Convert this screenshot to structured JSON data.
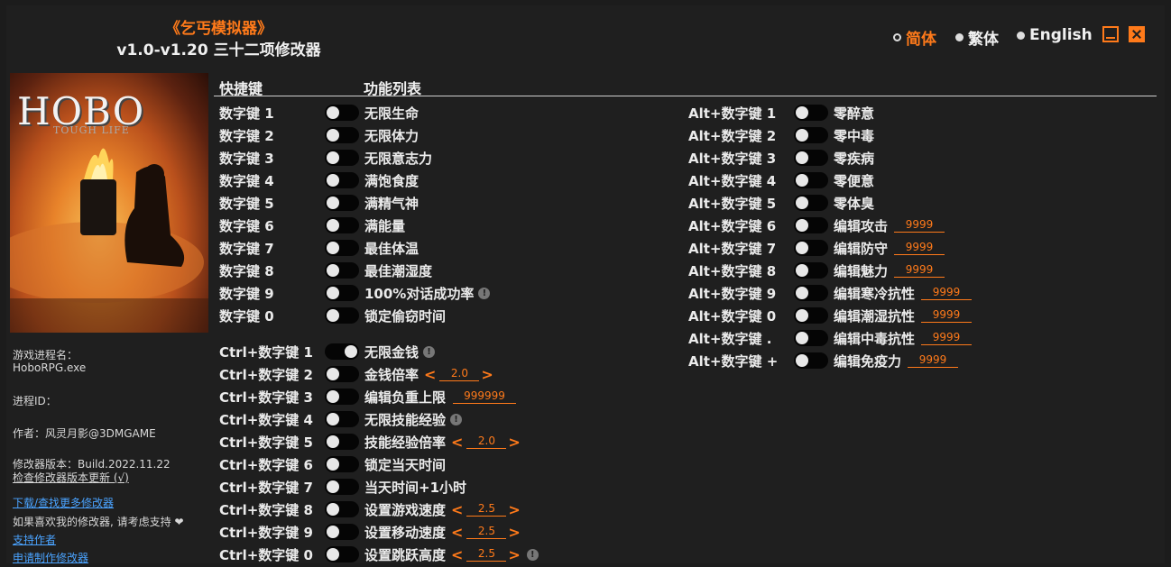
{
  "header": {
    "title": "《乞丐模拟器》",
    "subtitle": "v1.0-v1.20 三十二项修改器"
  },
  "languages": [
    {
      "label": "简体",
      "selected": true
    },
    {
      "label": "繁体",
      "selected": false
    },
    {
      "label": "English",
      "selected": false
    }
  ],
  "cover": {
    "logo": "HOBO",
    "logo_sub": "TOUGH LIFE"
  },
  "sidebar": {
    "process_label": "游戏进程名：",
    "process_value": "HoboRPG.exe",
    "pid_label": "进程ID：",
    "author": "作者：风灵月影@3DMGAME",
    "version": "修改器版本：Build.2022.11.22",
    "check_update": "检查修改器版本更新 (√)",
    "download_link": "下载/查找更多修改器",
    "support_text": "如果喜欢我的修改器, 请考虑支持 ❤",
    "support_link": "支持作者",
    "request_link": "申请制作修改器"
  },
  "columns": {
    "hotkey": "快捷键",
    "function": "功能列表"
  },
  "left_rows": [
    {
      "hotkey": "数字键 1",
      "label": "无限生命"
    },
    {
      "hotkey": "数字键 2",
      "label": "无限体力"
    },
    {
      "hotkey": "数字键 3",
      "label": "无限意志力"
    },
    {
      "hotkey": "数字键 4",
      "label": "满饱食度"
    },
    {
      "hotkey": "数字键 5",
      "label": "满精气神"
    },
    {
      "hotkey": "数字键 6",
      "label": "满能量"
    },
    {
      "hotkey": "数字键 7",
      "label": "最佳体温"
    },
    {
      "hotkey": "数字键 8",
      "label": "最佳潮湿度"
    },
    {
      "hotkey": "数字键 9",
      "label": "100%对话成功率",
      "info": "!"
    },
    {
      "hotkey": "数字键 0",
      "label": "锁定偷窃时间"
    },
    {
      "hotkey": "Ctrl+数字键 1",
      "label": "无限金钱",
      "info": "!",
      "on": true
    },
    {
      "hotkey": "Ctrl+数字键 2",
      "label": "金钱倍率",
      "value": "2.0",
      "arrows": true
    },
    {
      "hotkey": "Ctrl+数字键 3",
      "label": "编辑负重上限",
      "value": "999999"
    },
    {
      "hotkey": "Ctrl+数字键 4",
      "label": "无限技能经验",
      "info": "!"
    },
    {
      "hotkey": "Ctrl+数字键 5",
      "label": "技能经验倍率",
      "value": "2.0",
      "arrows": true
    },
    {
      "hotkey": "Ctrl+数字键 6",
      "label": "锁定当天时间"
    },
    {
      "hotkey": "Ctrl+数字键 7",
      "label": "当天时间+1小时"
    },
    {
      "hotkey": "Ctrl+数字键 8",
      "label": "设置游戏速度",
      "value": "2.5",
      "arrows": true
    },
    {
      "hotkey": "Ctrl+数字键 9",
      "label": "设置移动速度",
      "value": "2.5",
      "arrows": true
    },
    {
      "hotkey": "Ctrl+数字键 0",
      "label": "设置跳跃高度",
      "value": "2.5",
      "arrows": true,
      "info": "!"
    }
  ],
  "right_rows": [
    {
      "hotkey": "Alt+数字键 1",
      "label": "零醉意"
    },
    {
      "hotkey": "Alt+数字键 2",
      "label": "零中毒"
    },
    {
      "hotkey": "Alt+数字键 3",
      "label": "零疾病"
    },
    {
      "hotkey": "Alt+数字键 4",
      "label": "零便意"
    },
    {
      "hotkey": "Alt+数字键 5",
      "label": "零体臭"
    },
    {
      "hotkey": "Alt+数字键 6",
      "label": "编辑攻击",
      "value": "9999"
    },
    {
      "hotkey": "Alt+数字键 7",
      "label": "编辑防守",
      "value": "9999"
    },
    {
      "hotkey": "Alt+数字键 8",
      "label": "编辑魅力",
      "value": "9999"
    },
    {
      "hotkey": "Alt+数字键 9",
      "label": "编辑寒冷抗性",
      "value": "9999"
    },
    {
      "hotkey": "Alt+数字键 0",
      "label": "编辑潮湿抗性",
      "value": "9999"
    },
    {
      "hotkey": "Alt+数字键 .",
      "label": "编辑中毒抗性",
      "value": "9999"
    },
    {
      "hotkey": "Alt+数字键 +",
      "label": "编辑免疫力",
      "value": "9999"
    }
  ],
  "colors": {
    "accent": "#ff7a1a",
    "background": "#1f1f1f",
    "link": "#4aa3ff"
  }
}
